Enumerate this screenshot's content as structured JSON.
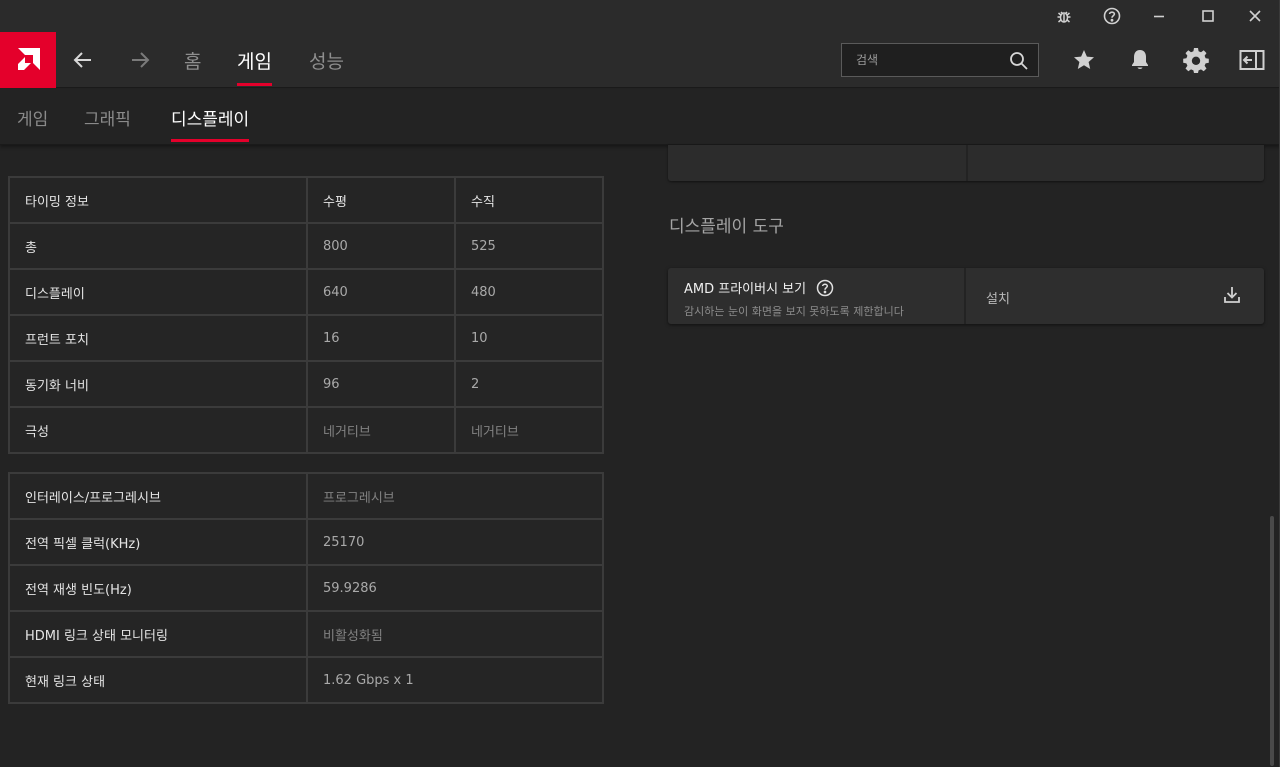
{
  "titlebar": {
    "icons": [
      "bug-icon",
      "help-icon",
      "minimize-icon",
      "maximize-icon",
      "close-icon"
    ]
  },
  "nav": {
    "tabs": [
      {
        "label": "홈",
        "active": false
      },
      {
        "label": "게임",
        "active": true
      },
      {
        "label": "성능",
        "active": false
      }
    ],
    "search_placeholder": "검색"
  },
  "subnav": {
    "tabs": [
      {
        "label": "게임",
        "active": false
      },
      {
        "label": "그래픽",
        "active": false
      },
      {
        "label": "디스플레이",
        "active": true
      }
    ]
  },
  "timing_table": {
    "headers": [
      "타이밍 정보",
      "수평",
      "수직"
    ],
    "rows": [
      [
        "총",
        "800",
        "525"
      ],
      [
        "디스플레이",
        "640",
        "480"
      ],
      [
        "프런트 포치",
        "16",
        "10"
      ],
      [
        "동기화 너비",
        "96",
        "2"
      ],
      [
        "극성",
        "네거티브",
        "네거티브"
      ]
    ]
  },
  "info_table": {
    "rows": [
      [
        "인터레이스/프로그레시브",
        "프로그레시브"
      ],
      [
        "전역 픽셀 클럭(KHz)",
        "25170"
      ],
      [
        "전역 재생 빈도(Hz)",
        "59.9286"
      ],
      [
        "HDMI 링크 상태 모니터링",
        "비활성화됨"
      ],
      [
        "현재 링크 상태",
        "1.62 Gbps x 1"
      ]
    ]
  },
  "display_tools": {
    "section_title": "디스플레이 도구",
    "privacy_view": {
      "title": "AMD 프라이버시 보기",
      "description": "감시하는 눈이 화면을 보지 못하도록 제한합니다",
      "action_label": "설치"
    }
  },
  "colors": {
    "accent": "#e4002b",
    "background": "#232323",
    "bar": "#2b2b2b"
  }
}
